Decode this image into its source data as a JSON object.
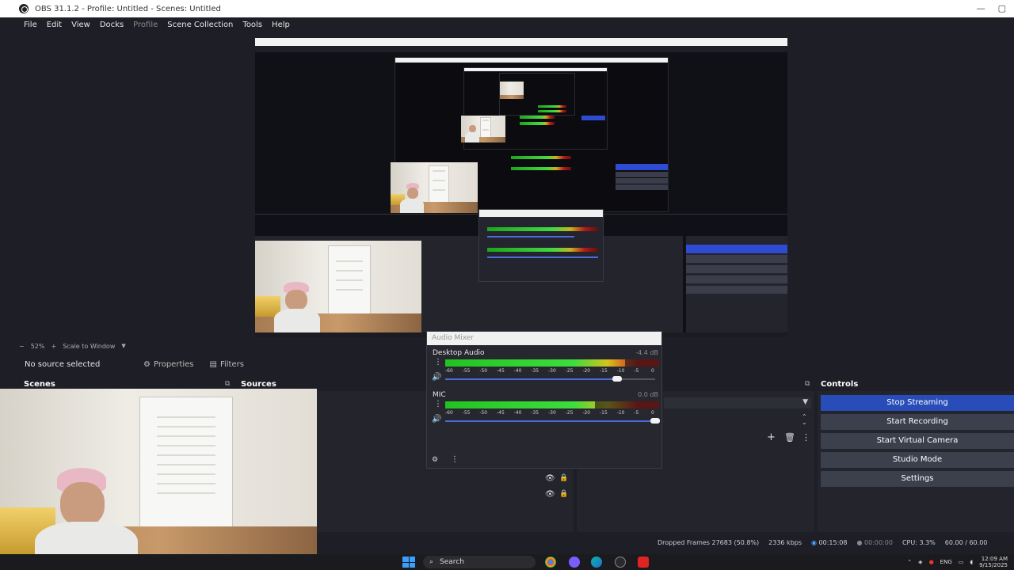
{
  "window": {
    "title": "OBS 31.1.2 - Profile: Untitled - Scenes: Untitled",
    "minimize": "—",
    "maximize": "▢"
  },
  "menu": [
    "File",
    "Edit",
    "View",
    "Docks",
    "Profile",
    "Scene Collection",
    "Tools",
    "Help"
  ],
  "preview": {
    "zoom": "52%",
    "scale_mode": "Scale to Window",
    "minus": "−",
    "plus": "+"
  },
  "source_toolbar": {
    "no_source": "No source selected",
    "properties": "Properties",
    "filters": "Filters"
  },
  "docks": {
    "scenes": "Scenes",
    "sources": "Sources",
    "controls": "Controls"
  },
  "controls": {
    "stop_streaming": "Stop Streaming",
    "start_recording": "Start Recording",
    "start_virtual_camera": "Start Virtual Camera",
    "studio_mode": "Studio Mode",
    "settings": "Settings"
  },
  "audio_mixer": {
    "title": "Audio Mixer",
    "ticks": [
      "-60",
      "-55",
      "-50",
      "-45",
      "-40",
      "-35",
      "-30",
      "-25",
      "-20",
      "-15",
      "-10",
      "-5",
      "0"
    ],
    "channels": [
      {
        "name": "Desktop Audio",
        "db": "-4.4 dB",
        "level": 0.84,
        "volume": 0.82
      },
      {
        "name": "MIC",
        "db": "0.0 dB",
        "level": 0.7,
        "volume": 1.0
      }
    ]
  },
  "status": {
    "dropped_frames": "Dropped Frames 27683 (50.8%)",
    "bitrate": "2336 kbps",
    "stream_time": "00:15:08",
    "rec_time": "00:00:00",
    "cpu": "CPU: 3.3%",
    "fps": "60.00 / 60.00"
  },
  "taskbar": {
    "search": "Search",
    "lang": "ENG",
    "time": "12:09 AM",
    "date": "9/15/2025"
  },
  "colors": {
    "accent": "#284cb8",
    "panel": "#23242c",
    "background": "#1e1f26"
  }
}
